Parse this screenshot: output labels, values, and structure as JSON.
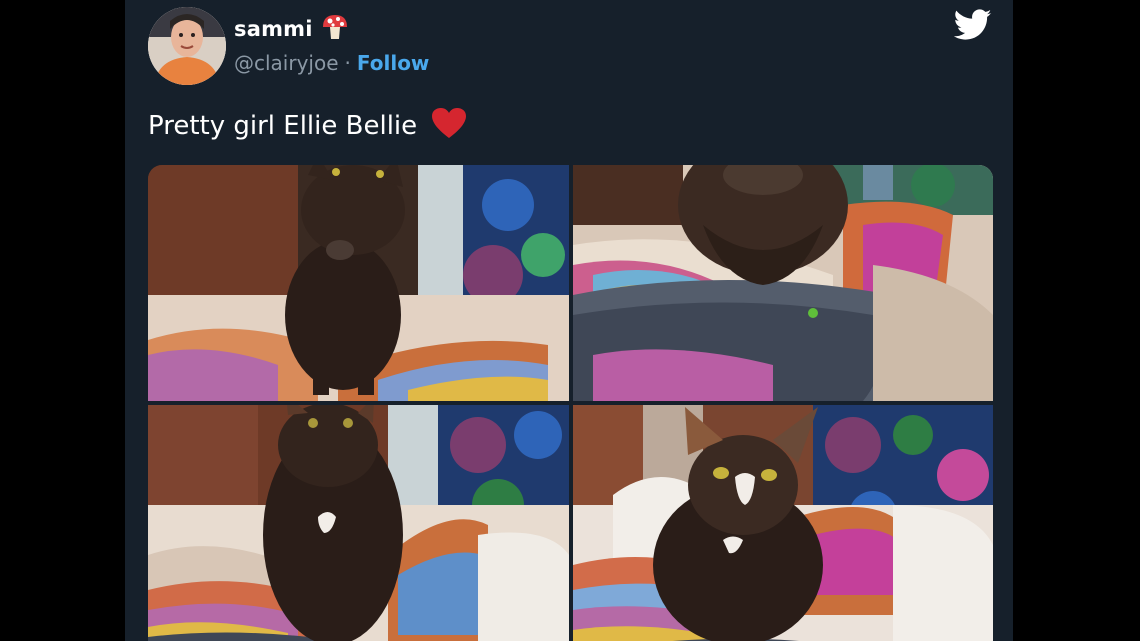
{
  "tweet": {
    "display_name": "sammi",
    "name_emoji": "mushroom-icon",
    "handle": "@clairyjoe",
    "separator": "·",
    "follow_label": "Follow",
    "text": "Pretty girl Ellie Bellie",
    "text_emoji": "red-heart-icon"
  },
  "media": {
    "photos": [
      {
        "name": "cat-photo-1"
      },
      {
        "name": "cat-photo-2"
      },
      {
        "name": "cat-photo-3"
      },
      {
        "name": "cat-photo-4"
      }
    ]
  },
  "colors": {
    "card_background": "#16202b",
    "follow_link": "#4aa8ec",
    "handle_text": "#8b98a5",
    "heart": "#e0245e"
  }
}
